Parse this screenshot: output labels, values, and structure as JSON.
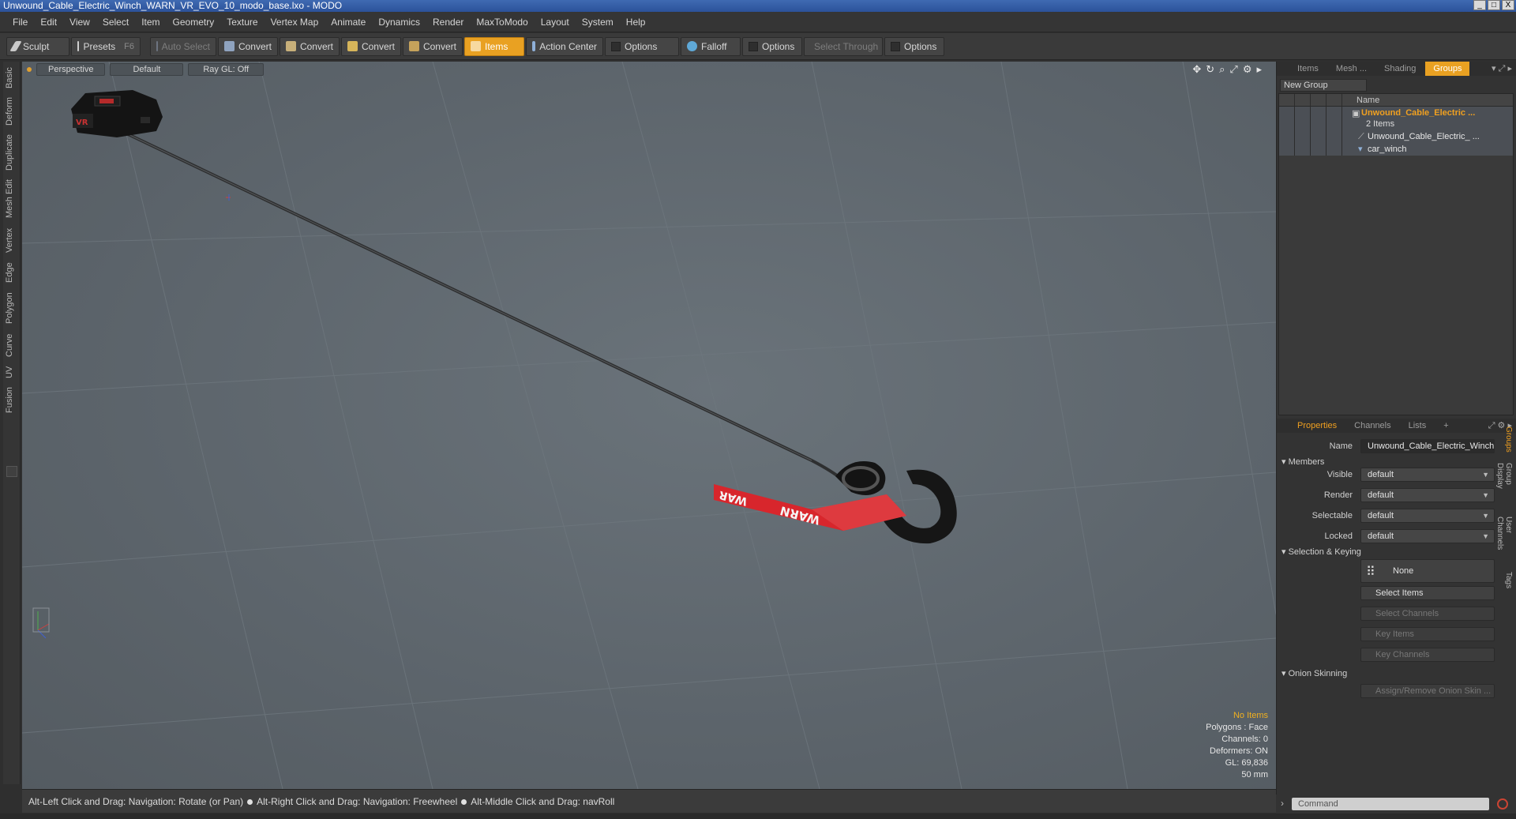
{
  "window": {
    "title": "Unwound_Cable_Electric_Winch_WARN_VR_EVO_10_modo_base.lxo - MODO",
    "controls": [
      "_",
      "□",
      "X"
    ]
  },
  "menu": [
    "File",
    "Edit",
    "View",
    "Select",
    "Item",
    "Geometry",
    "Texture",
    "Vertex Map",
    "Animate",
    "Dynamics",
    "Render",
    "MaxToModo",
    "Layout",
    "System",
    "Help"
  ],
  "toolbar": {
    "sculpt": "Sculpt",
    "presets": "Presets",
    "presets_key": "F6",
    "auto_select": "Auto Select",
    "convert1": "Convert",
    "convert2": "Convert",
    "convert3": "Convert",
    "convert4": "Convert",
    "items": "Items",
    "action_center": "Action Center",
    "options1": "Options",
    "falloff": "Falloff",
    "options2": "Options",
    "select_through": "Select Through",
    "options3": "Options"
  },
  "left_tabs": [
    "Basic",
    "Deform",
    "Duplicate",
    "Mesh Edit",
    "Vertex",
    "Edge",
    "Polygon",
    "Curve",
    "UV",
    "Fusion"
  ],
  "viewport": {
    "view_mode": "Perspective",
    "shading": "Default",
    "raygl": "Ray GL: Off",
    "scene_labels": {
      "strap_text": "WARN",
      "strap_text_partial": "WAR",
      "winch_badge": "VR"
    },
    "info": {
      "items": "No Items",
      "polygons": "Polygons : Face",
      "channels": "Channels: 0",
      "deformers": "Deformers: ON",
      "gl": "GL: 69,836",
      "focal": "50 mm"
    }
  },
  "status": {
    "part1": "Alt-Left Click and Drag: Navigation: Rotate (or Pan)",
    "part2": "Alt-Right Click and Drag: Navigation: Freewheel",
    "part3": "Alt-Middle Click and Drag: navRoll"
  },
  "right_top_tabs": [
    "Items",
    "Mesh ...",
    "Shading",
    "Groups"
  ],
  "groups": {
    "new_group": "New Group",
    "column_name": "Name",
    "group_name": "Unwound_Cable_Electric ...",
    "group_count": "2 Items",
    "children": [
      "Unwound_Cable_Electric_ ...",
      "car_winch"
    ]
  },
  "props_tabs": [
    "Properties",
    "Channels",
    "Lists",
    "+"
  ],
  "properties": {
    "name_label": "Name",
    "name_value": "Unwound_Cable_Electric_Winch_",
    "members_header": "Members",
    "visible_label": "Visible",
    "visible_value": "default",
    "render_label": "Render",
    "render_value": "default",
    "selectable_label": "Selectable",
    "selectable_value": "default",
    "locked_label": "Locked",
    "locked_value": "default",
    "sel_key_header": "Selection & Keying",
    "none_btn": "None",
    "select_items": "Select Items",
    "select_channels": "Select Channels",
    "key_items": "Key Items",
    "key_channels": "Key Channels",
    "onion_header": "Onion Skinning",
    "assign_onion": "Assign/Remove Onion Skin ..."
  },
  "right_vtabs": [
    "Groups",
    "Group Display",
    "User Channels",
    "Tags"
  ],
  "command": {
    "placeholder": "Command"
  },
  "colors": {
    "accent": "#e9a122",
    "strap_red": "#d8262c",
    "viewport_bg": "#5f676d"
  }
}
